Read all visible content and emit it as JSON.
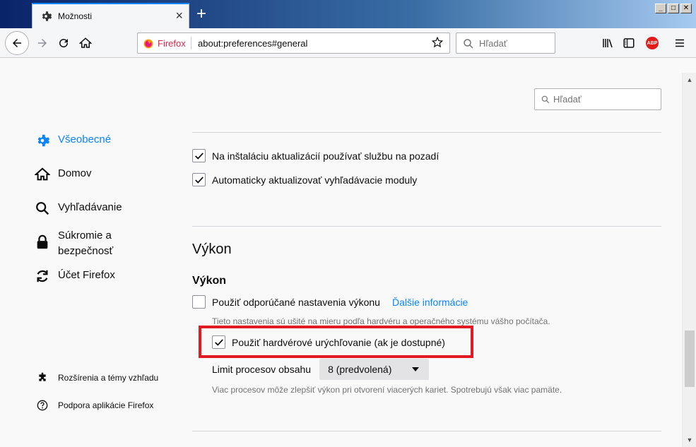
{
  "window": {
    "tab_title": "Možnosti",
    "min": "_",
    "max": "□",
    "close": "✕"
  },
  "navbar": {
    "identity_label": "Firefox",
    "url": "about:preferences#general",
    "search_placeholder": "Hľadať"
  },
  "prefs_search_placeholder": "Hľadať",
  "sidebar": {
    "items": [
      {
        "label": "Všeobecné",
        "icon": "gear-icon",
        "selected": true
      },
      {
        "label": "Domov",
        "icon": "home-icon"
      },
      {
        "label": "Vyhľadávanie",
        "icon": "search-icon"
      },
      {
        "label": "Súkromie a bezpečnosť",
        "icon": "lock-icon"
      },
      {
        "label": "Účet Firefox",
        "icon": "sync-icon"
      }
    ],
    "footer": [
      {
        "label": "Rozšírenia a témy vzhľadu",
        "icon": "puzzle-icon"
      },
      {
        "label": "Podpora aplikácie Firefox",
        "icon": "help-icon"
      }
    ]
  },
  "updates": {
    "background_service": {
      "pre": "Na inštaláciu aktualizácií používať službu na pozadí",
      "checked": true
    },
    "auto_update_search": {
      "pre": "Automaticky aktualizovať vyhľadávacie moduly",
      "checked": true
    }
  },
  "performance": {
    "section_title": "Výkon",
    "group_title": "Výkon",
    "recommended": {
      "label": "Použiť odporúčané nastavenia výkonu",
      "checked": false
    },
    "learn_more": "Ďalšie informácie",
    "recommended_desc": "Tieto nastavenia sú ušité na mieru podľa hardvéru a operačného systému vášho počítača.",
    "hw_accel": {
      "label": "Použiť hardvérové urýchľovanie (ak je dostupné)",
      "checked": true
    },
    "content_process_label": "Limit procesov obsahu",
    "content_process_value": "8 (predvolená)",
    "content_process_desc": "Viac procesov môže zlepšiť výkon pri otvorení viacerých kariet. Spotrebujú však viac pamäte."
  },
  "colors": {
    "accent": "#0a84ff",
    "highlight": "#e21a24"
  }
}
